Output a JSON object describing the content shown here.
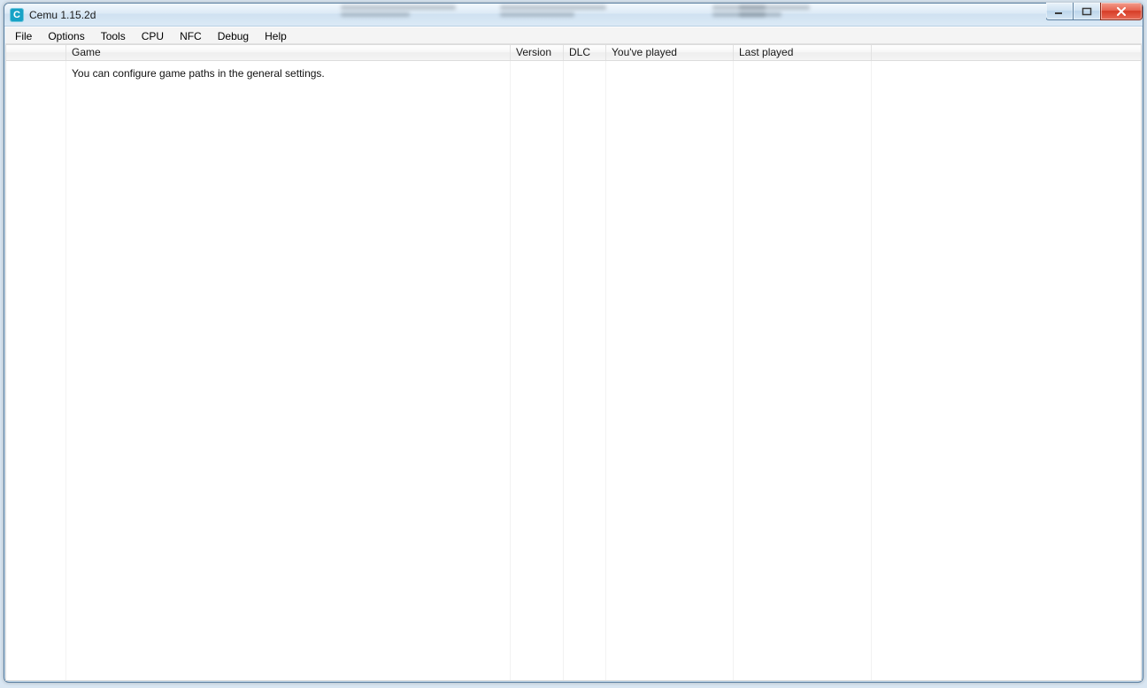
{
  "window": {
    "title": "Cemu 1.15.2d",
    "app_icon_letter": "C"
  },
  "menu": {
    "items": [
      "File",
      "Options",
      "Tools",
      "CPU",
      "NFC",
      "Debug",
      "Help"
    ]
  },
  "list": {
    "columns": {
      "game": "Game",
      "version": "Version",
      "dlc": "DLC",
      "played": "You've played",
      "last": "Last played"
    },
    "empty_hint": "You can configure game paths in the general settings."
  }
}
